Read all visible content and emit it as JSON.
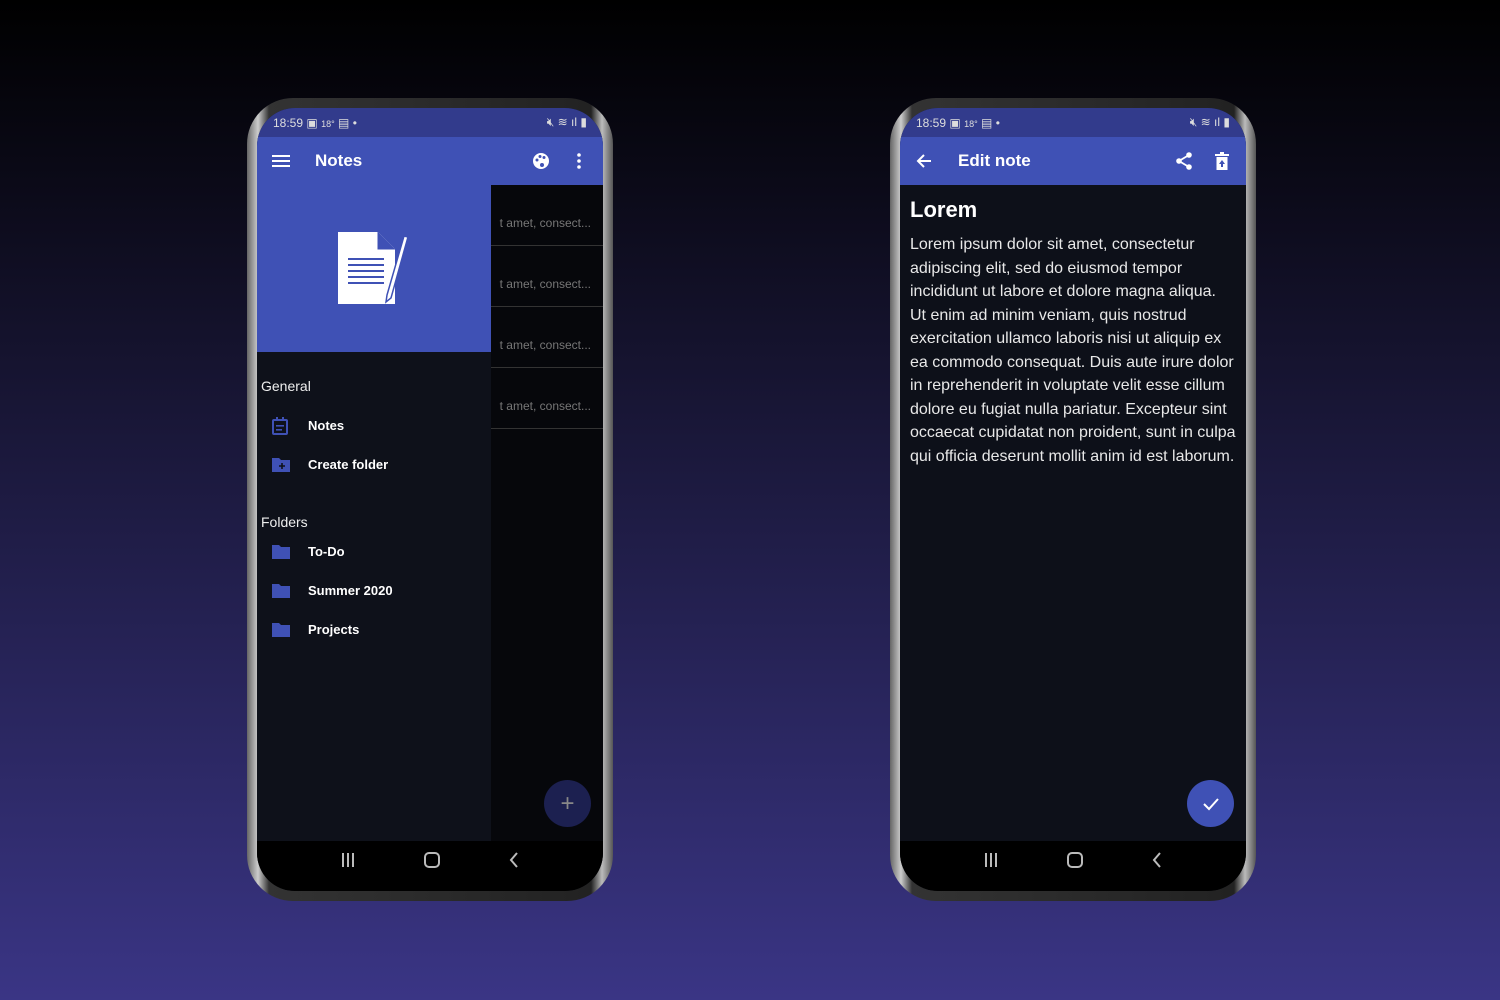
{
  "colors": {
    "primary": "#3f51b5",
    "status": "#323b8c",
    "background": "#0d1019"
  },
  "left": {
    "status": {
      "time": "18:59",
      "temp": "18°"
    },
    "appbar": {
      "title": "Notes",
      "icons": [
        "menu-icon",
        "palette-icon",
        "more-vert-icon"
      ]
    },
    "notes_preview": [
      "t amet, consect...",
      "t amet, consect...",
      "t amet, consect...",
      "t amet, consect..."
    ],
    "drawer": {
      "general_label": "General",
      "general": [
        {
          "label": "Notes",
          "icon": "notes-icon"
        },
        {
          "label": "Create folder",
          "icon": "create-folder-icon"
        }
      ],
      "folders_label": "Folders",
      "folders": [
        {
          "label": "To-Do"
        },
        {
          "label": "Summer 2020"
        },
        {
          "label": "Projects"
        }
      ]
    },
    "fab": "+"
  },
  "right": {
    "status": {
      "time": "18:59",
      "temp": "18°"
    },
    "appbar": {
      "title": "Edit note",
      "icons": [
        "back-arrow-icon",
        "share-icon",
        "delete-icon"
      ]
    },
    "note": {
      "title": "Lorem",
      "body": "Lorem ipsum dolor sit amet, consectetur adipiscing elit, sed do eiusmod tempor incididunt ut labore et dolore magna aliqua. Ut enim ad minim veniam, quis nostrud exercitation ullamco laboris nisi ut aliquip ex ea commodo consequat. Duis aute irure dolor in reprehenderit in voluptate velit esse cillum dolore eu fugiat nulla pariatur. Excepteur sint occaecat cupidatat non proident, sunt in culpa qui officia deserunt mollit anim id est laborum."
    }
  }
}
